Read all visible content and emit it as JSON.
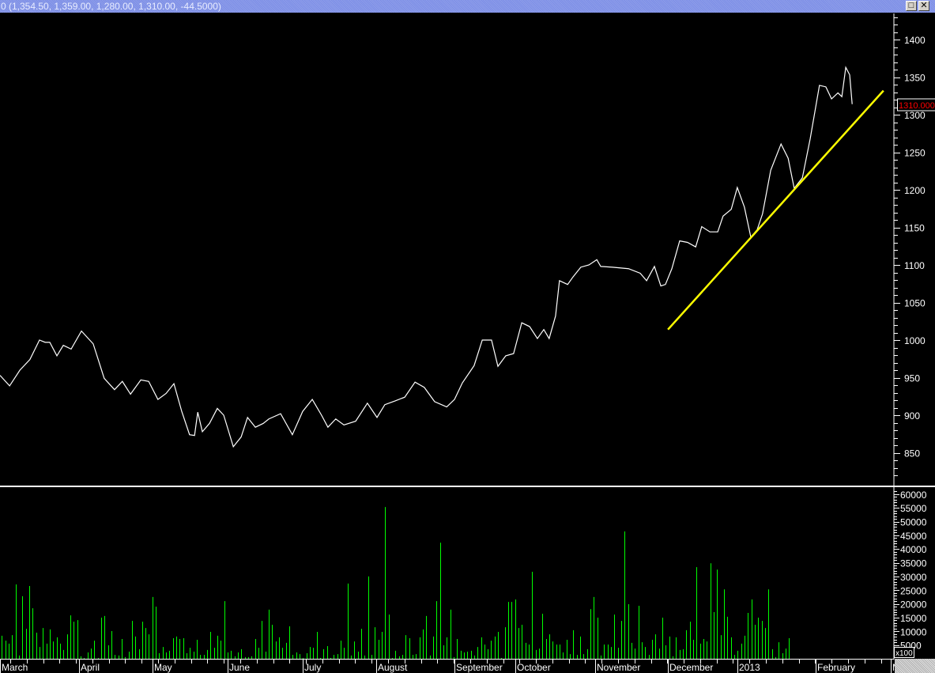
{
  "window": {
    "title": "0 (1,354.50, 1,359.00, 1,280.00, 1,310.00, -44.5000)",
    "maximize_icon": "maximize-icon",
    "close_icon": "close-icon",
    "maximize_label": "□",
    "close_label": "✕"
  },
  "chart_data": [
    {
      "type": "line",
      "title": "Price",
      "ylim": [
        810,
        1430
      ],
      "yticks": [
        850,
        900,
        950,
        1000,
        1050,
        1100,
        1150,
        1200,
        1250,
        1300,
        1350,
        1400
      ],
      "last_value_label": "1310.000",
      "colors": {
        "line": "#ffffff",
        "trendline": "#ffff00",
        "last_value": "#ff0000"
      },
      "x_unit": "trading day",
      "points": [
        [
          0,
          953
        ],
        [
          2.7,
          939
        ],
        [
          5.6,
          960
        ],
        [
          8.4,
          974
        ],
        [
          11.1,
          1000
        ],
        [
          12.7,
          997
        ],
        [
          14,
          997
        ],
        [
          16,
          979
        ],
        [
          17.8,
          993
        ],
        [
          20,
          988
        ],
        [
          22.9,
          1012
        ],
        [
          26.2,
          995
        ],
        [
          29.3,
          949
        ],
        [
          32.2,
          934
        ],
        [
          34.4,
          945
        ],
        [
          36.7,
          928
        ],
        [
          39.6,
          947
        ],
        [
          41.8,
          945
        ],
        [
          44.4,
          921
        ],
        [
          46.7,
          929
        ],
        [
          48.9,
          942
        ],
        [
          51.1,
          905
        ],
        [
          53.3,
          874
        ],
        [
          54.7,
          873
        ],
        [
          55.6,
          904
        ],
        [
          56.9,
          878
        ],
        [
          58.9,
          889
        ],
        [
          61.1,
          909
        ],
        [
          62.9,
          900
        ],
        [
          65.6,
          858
        ],
        [
          67.8,
          871
        ],
        [
          69.6,
          897
        ],
        [
          71.8,
          884
        ],
        [
          74,
          889
        ],
        [
          75.6,
          895
        ],
        [
          78.9,
          902
        ],
        [
          82.2,
          874
        ],
        [
          85.1,
          905
        ],
        [
          87.8,
          921
        ],
        [
          90.4,
          900
        ],
        [
          92.2,
          884
        ],
        [
          94.4,
          895
        ],
        [
          96.7,
          887
        ],
        [
          100,
          892
        ],
        [
          103.3,
          916
        ],
        [
          106,
          897
        ],
        [
          108.2,
          914
        ],
        [
          111.1,
          919
        ],
        [
          113.8,
          924
        ],
        [
          116.7,
          944
        ],
        [
          119.3,
          937
        ],
        [
          122.2,
          918
        ],
        [
          125.6,
          911
        ],
        [
          127.8,
          921
        ],
        [
          130,
          943
        ],
        [
          133.3,
          966
        ],
        [
          135.6,
          1000
        ],
        [
          138.2,
          1000
        ],
        [
          140,
          965
        ],
        [
          142.2,
          979
        ],
        [
          144.4,
          982
        ],
        [
          146.7,
          1023
        ],
        [
          148.9,
          1018
        ],
        [
          151.1,
          1002
        ],
        [
          152.9,
          1014
        ],
        [
          154.4,
          1002
        ],
        [
          156.2,
          1032
        ],
        [
          157.3,
          1079
        ],
        [
          159.6,
          1074
        ],
        [
          161.1,
          1084
        ],
        [
          163.3,
          1097
        ],
        [
          165.6,
          1100
        ],
        [
          167.8,
          1107
        ],
        [
          168.9,
          1098
        ],
        [
          172.2,
          1097
        ],
        [
          176.7,
          1095
        ],
        [
          180,
          1089
        ],
        [
          181.8,
          1079
        ],
        [
          184,
          1098
        ],
        [
          185.8,
          1072
        ],
        [
          187.1,
          1074
        ],
        [
          188.9,
          1095
        ],
        [
          191.1,
          1132
        ],
        [
          193.3,
          1130
        ],
        [
          195.6,
          1124
        ],
        [
          197.3,
          1151
        ],
        [
          199.6,
          1144
        ],
        [
          201.8,
          1144
        ],
        [
          203.3,
          1165
        ],
        [
          205.6,
          1174
        ],
        [
          207.3,
          1203
        ],
        [
          209.3,
          1177
        ],
        [
          211.1,
          1137
        ],
        [
          212.9,
          1147
        ],
        [
          214.4,
          1168
        ],
        [
          216.7,
          1226
        ],
        [
          219.6,
          1261
        ],
        [
          221.6,
          1242
        ],
        [
          223.3,
          1202
        ],
        [
          225.6,
          1216
        ],
        [
          227.8,
          1268
        ],
        [
          230.4,
          1339
        ],
        [
          232.2,
          1337
        ],
        [
          233.8,
          1321
        ],
        [
          235.6,
          1329
        ],
        [
          236.7,
          1324
        ],
        [
          237.8,
          1363
        ],
        [
          238.9,
          1353
        ],
        [
          239.6,
          1314
        ]
      ],
      "trendline": [
        [
          187.8,
          1014
        ],
        [
          248.4,
          1332
        ]
      ]
    },
    {
      "type": "bar",
      "title": "Volume",
      "ylim": [
        0,
        62000
      ],
      "yticks": [
        5000,
        10000,
        15000,
        20000,
        25000,
        30000,
        35000,
        40000,
        45000,
        50000,
        55000,
        60000
      ],
      "multiplier_label": "x100",
      "colors": {
        "bar": "#00ff00"
      },
      "values": [
        8400,
        6600,
        5500,
        8600,
        27100,
        1200,
        22800,
        10900,
        26500,
        18400,
        9500,
        4300,
        11200,
        5500,
        10700,
        6300,
        7800,
        5500,
        3200,
        8900,
        15800,
        13500,
        14100,
        900,
        300,
        2300,
        3700,
        6600,
        300,
        15000,
        15600,
        4900,
        10100,
        1400,
        1200,
        7200,
        600,
        2600,
        13800,
        8100,
        3500,
        13500,
        11200,
        8900,
        22500,
        19000,
        2000,
        4300,
        2300,
        2900,
        7500,
        8100,
        7200,
        7500,
        2000,
        4000,
        2600,
        6900,
        1400,
        1400,
        3200,
        9800,
        4000,
        8400,
        6600,
        21000,
        2300,
        2900,
        900,
        2300,
        3500,
        600,
        600,
        900,
        7200,
        4000,
        13800,
        2600,
        17900,
        12400,
        6300,
        7800,
        4000,
        5800,
        11800,
        1400,
        2300,
        1700,
        300,
        2000,
        4300,
        4000,
        9800,
        300,
        3500,
        4600,
        300,
        1400,
        1700,
        6600,
        4000,
        27400,
        1200,
        6300,
        2600,
        10900,
        1200,
        30000,
        1400,
        11500,
        6900,
        9800,
        55300,
        16100,
        300,
        2900,
        900,
        1400,
        8600,
        7500,
        1400,
        1700,
        7800,
        10700,
        15600,
        1200,
        8100,
        21000,
        42300,
        4900,
        7800,
        17900,
        600,
        7200,
        2900,
        2300,
        2600,
        2900,
        1200,
        4300,
        7800,
        5200,
        3500,
        6600,
        8100,
        9800,
        300,
        11500,
        20700,
        20700,
        21600,
        11200,
        12400,
        5800,
        5200,
        31700,
        3200,
        3700,
        16400,
        7200,
        8900,
        6300,
        5200,
        5200,
        2300,
        6900,
        1700,
        10400,
        1400,
        8100,
        1700,
        3500,
        18100,
        22500,
        15000,
        1200,
        5200,
        5200,
        4300,
        16100,
        4000,
        13800,
        46400,
        19900,
        5800,
        3700,
        19300,
        6000,
        4300,
        1400,
        6900,
        8900,
        3700,
        15000,
        4900,
        8100,
        900,
        7800,
        3200,
        3500,
        10400,
        13500,
        6900,
        33400,
        5500,
        7200,
        6300,
        34800,
        17000,
        32500,
        8600,
        25300,
        15300,
        7800,
        1400,
        2900,
        5500,
        8400,
        16700,
        21600,
        12400,
        15000,
        13800,
        11200,
        25300,
        3500,
        600,
        6000,
        2000,
        3700,
        7500
      ]
    }
  ],
  "x_axis": {
    "months": [
      {
        "label": "March",
        "day": 0
      },
      {
        "label": "April",
        "day": 23.1
      },
      {
        "label": "May",
        "day": 44.6
      },
      {
        "label": "June",
        "day": 66.5
      },
      {
        "label": "July",
        "day": 88.5
      },
      {
        "label": "August",
        "day": 109.9
      },
      {
        "label": "September",
        "day": 132.8
      },
      {
        "label": "October",
        "day": 150.6
      },
      {
        "label": "November",
        "day": 173.9
      },
      {
        "label": "December",
        "day": 195.2
      },
      {
        "label": "2013",
        "day": 215.5
      },
      {
        "label": "February",
        "day": 238.3
      },
      {
        "label": "M",
        "day": 260.3
      }
    ]
  }
}
